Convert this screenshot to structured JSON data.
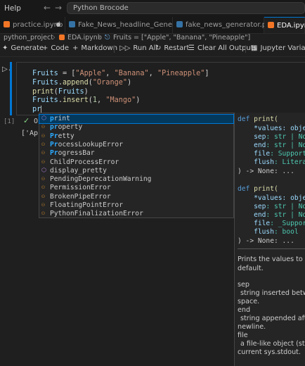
{
  "titlebar": {
    "menu": [
      "Help"
    ],
    "search": "Python Brocode"
  },
  "tabs": [
    {
      "label": "practice.ipynb",
      "modified": true,
      "active": false
    },
    {
      "label": "Fake_News_headline_Generate.py",
      "modified": false,
      "active": false
    },
    {
      "label": "fake_news_generator.py",
      "modified": false,
      "active": false
    },
    {
      "label": "EDA.ipynb",
      "modified": false,
      "active": true
    }
  ],
  "breadcrumb": {
    "folder": "python_project",
    "file": "EDA.ipynb",
    "symbol": "Fruits = [\"Apple\", \"Banana\", \"Pineapple\"]"
  },
  "toolbar": {
    "generate": "Generate",
    "code": "Code",
    "markdown": "Markdown",
    "run_all": "Run All",
    "restart": "Restart",
    "clear_all": "Clear All Outputs",
    "variables": "Jupyter Variables"
  },
  "cell": {
    "exec_count": "[1]",
    "exec_time": "0.",
    "output": "['App"
  },
  "suggestions": [
    {
      "match": "p",
      "rest": "rint",
      "kind": "method"
    },
    {
      "match": "pr",
      "rest": "operty",
      "kind": "class"
    },
    {
      "match": "Pr",
      "rest": "etty",
      "kind": "class"
    },
    {
      "match": "Pr",
      "rest": "ocessLookupError",
      "kind": "class"
    },
    {
      "match": "Pr",
      "rest": "ogressBar",
      "kind": "class"
    },
    {
      "match": "",
      "rest": "ChildProcessError",
      "kind": "class"
    },
    {
      "match": "",
      "rest": "display_pretty",
      "kind": "method"
    },
    {
      "match": "",
      "rest": "PendingDeprecationWarning",
      "kind": "class"
    },
    {
      "match": "",
      "rest": "PermissionError",
      "kind": "class"
    },
    {
      "match": "",
      "rest": "BrokenPipeError",
      "kind": "class"
    },
    {
      "match": "",
      "rest": "FloatingPointError",
      "kind": "class"
    },
    {
      "match": "",
      "rest": "PythonFinalizationError",
      "kind": "class"
    }
  ],
  "details": {
    "sig1": {
      "def": "def",
      "name": "print(",
      "l1": "*values: object",
      "l2a": "sep",
      "l2b": ": str | None",
      "l3a": "end",
      "l3b": ": str | None",
      "l4a": "file",
      "l4b": ": SupportsW",
      "l5a": "flush",
      "l5b": ": Literal[F",
      "ret": ") -> None: ..."
    },
    "sig2": {
      "def": "def",
      "name": "print(",
      "l1": "*values: object",
      "l2a": "sep",
      "l2b": ": str | None",
      "l3a": "end",
      "l3b": ": str | None",
      "l4a": "file",
      "l4b": ": _SupportsW",
      "l5a": "flush",
      "l5b": ": bool",
      "ret": ") -> None: ..."
    },
    "doc": {
      "p1": "Prints the values to a stre",
      "p2": "default.",
      "sep": "sep",
      "sep_d1": "string inserted between",
      "sep_d2": "space.",
      "end": "end",
      "end_d1": "string appended after t",
      "end_d2": "newline.",
      "file": "file",
      "file_d1": "a file-like object (strean",
      "file_d2": "current sys.stdout."
    }
  }
}
